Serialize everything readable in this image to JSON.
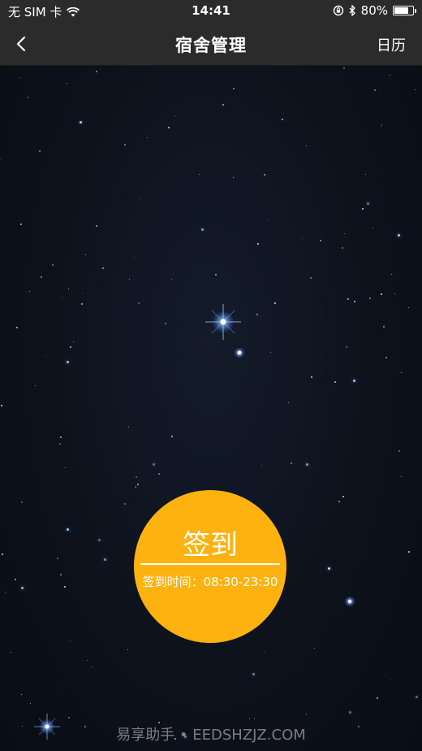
{
  "status_bar": {
    "carrier": "无 SIM 卡",
    "time": "14:41",
    "battery_percent": "80%",
    "battery_level": 0.8,
    "icons": [
      "wifi-icon",
      "orientation-lock-icon",
      "bluetooth-icon",
      "battery-icon"
    ]
  },
  "nav": {
    "title": "宿舍管理",
    "right_label": "日历",
    "back_icon": "chevron-left-icon"
  },
  "checkin": {
    "label": "签到",
    "time_text": "签到时间：08:30-23:30",
    "color": "#fdb20f"
  },
  "watermark": "易享助手 • EEDSHZJZ.COM",
  "colors": {
    "bar": "#2b2b2b",
    "sky": "#0b0f18",
    "accent": "#fdb20f"
  }
}
